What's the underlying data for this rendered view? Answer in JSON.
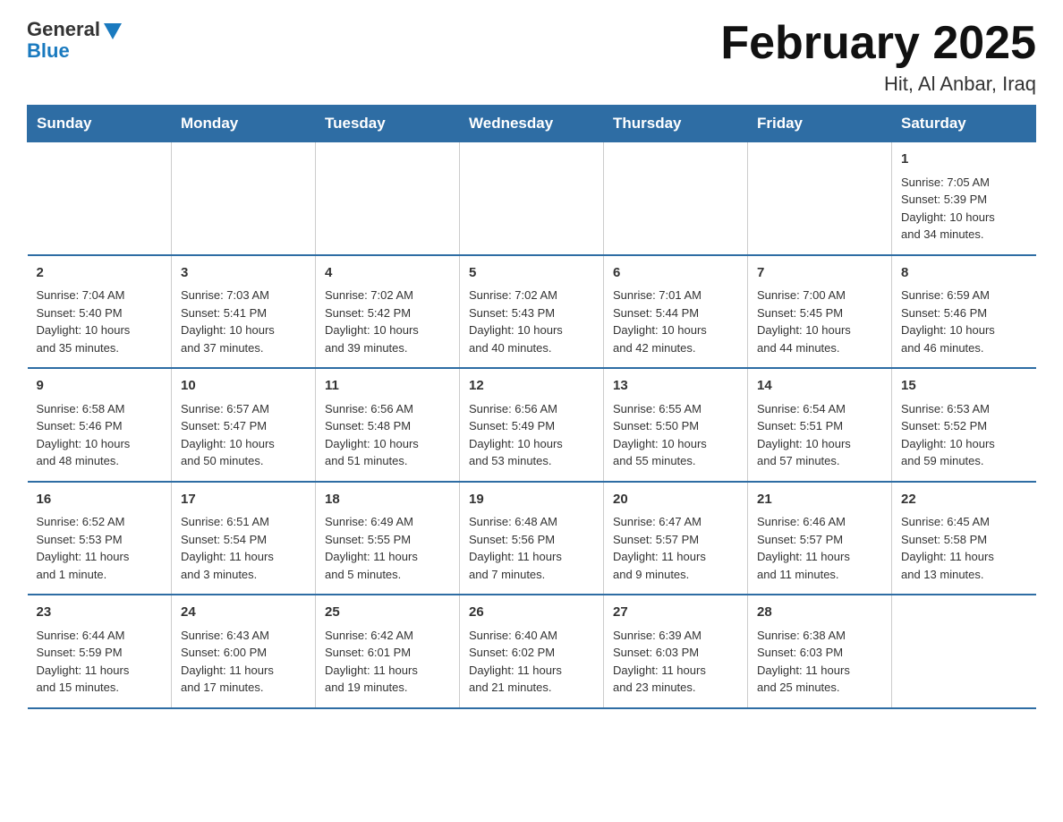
{
  "logo": {
    "general": "General",
    "blue": "Blue"
  },
  "title": "February 2025",
  "subtitle": "Hit, Al Anbar, Iraq",
  "days_of_week": [
    "Sunday",
    "Monday",
    "Tuesday",
    "Wednesday",
    "Thursday",
    "Friday",
    "Saturday"
  ],
  "weeks": [
    [
      {
        "day": "",
        "info": ""
      },
      {
        "day": "",
        "info": ""
      },
      {
        "day": "",
        "info": ""
      },
      {
        "day": "",
        "info": ""
      },
      {
        "day": "",
        "info": ""
      },
      {
        "day": "",
        "info": ""
      },
      {
        "day": "1",
        "info": "Sunrise: 7:05 AM\nSunset: 5:39 PM\nDaylight: 10 hours\nand 34 minutes."
      }
    ],
    [
      {
        "day": "2",
        "info": "Sunrise: 7:04 AM\nSunset: 5:40 PM\nDaylight: 10 hours\nand 35 minutes."
      },
      {
        "day": "3",
        "info": "Sunrise: 7:03 AM\nSunset: 5:41 PM\nDaylight: 10 hours\nand 37 minutes."
      },
      {
        "day": "4",
        "info": "Sunrise: 7:02 AM\nSunset: 5:42 PM\nDaylight: 10 hours\nand 39 minutes."
      },
      {
        "day": "5",
        "info": "Sunrise: 7:02 AM\nSunset: 5:43 PM\nDaylight: 10 hours\nand 40 minutes."
      },
      {
        "day": "6",
        "info": "Sunrise: 7:01 AM\nSunset: 5:44 PM\nDaylight: 10 hours\nand 42 minutes."
      },
      {
        "day": "7",
        "info": "Sunrise: 7:00 AM\nSunset: 5:45 PM\nDaylight: 10 hours\nand 44 minutes."
      },
      {
        "day": "8",
        "info": "Sunrise: 6:59 AM\nSunset: 5:46 PM\nDaylight: 10 hours\nand 46 minutes."
      }
    ],
    [
      {
        "day": "9",
        "info": "Sunrise: 6:58 AM\nSunset: 5:46 PM\nDaylight: 10 hours\nand 48 minutes."
      },
      {
        "day": "10",
        "info": "Sunrise: 6:57 AM\nSunset: 5:47 PM\nDaylight: 10 hours\nand 50 minutes."
      },
      {
        "day": "11",
        "info": "Sunrise: 6:56 AM\nSunset: 5:48 PM\nDaylight: 10 hours\nand 51 minutes."
      },
      {
        "day": "12",
        "info": "Sunrise: 6:56 AM\nSunset: 5:49 PM\nDaylight: 10 hours\nand 53 minutes."
      },
      {
        "day": "13",
        "info": "Sunrise: 6:55 AM\nSunset: 5:50 PM\nDaylight: 10 hours\nand 55 minutes."
      },
      {
        "day": "14",
        "info": "Sunrise: 6:54 AM\nSunset: 5:51 PM\nDaylight: 10 hours\nand 57 minutes."
      },
      {
        "day": "15",
        "info": "Sunrise: 6:53 AM\nSunset: 5:52 PM\nDaylight: 10 hours\nand 59 minutes."
      }
    ],
    [
      {
        "day": "16",
        "info": "Sunrise: 6:52 AM\nSunset: 5:53 PM\nDaylight: 11 hours\nand 1 minute."
      },
      {
        "day": "17",
        "info": "Sunrise: 6:51 AM\nSunset: 5:54 PM\nDaylight: 11 hours\nand 3 minutes."
      },
      {
        "day": "18",
        "info": "Sunrise: 6:49 AM\nSunset: 5:55 PM\nDaylight: 11 hours\nand 5 minutes."
      },
      {
        "day": "19",
        "info": "Sunrise: 6:48 AM\nSunset: 5:56 PM\nDaylight: 11 hours\nand 7 minutes."
      },
      {
        "day": "20",
        "info": "Sunrise: 6:47 AM\nSunset: 5:57 PM\nDaylight: 11 hours\nand 9 minutes."
      },
      {
        "day": "21",
        "info": "Sunrise: 6:46 AM\nSunset: 5:57 PM\nDaylight: 11 hours\nand 11 minutes."
      },
      {
        "day": "22",
        "info": "Sunrise: 6:45 AM\nSunset: 5:58 PM\nDaylight: 11 hours\nand 13 minutes."
      }
    ],
    [
      {
        "day": "23",
        "info": "Sunrise: 6:44 AM\nSunset: 5:59 PM\nDaylight: 11 hours\nand 15 minutes."
      },
      {
        "day": "24",
        "info": "Sunrise: 6:43 AM\nSunset: 6:00 PM\nDaylight: 11 hours\nand 17 minutes."
      },
      {
        "day": "25",
        "info": "Sunrise: 6:42 AM\nSunset: 6:01 PM\nDaylight: 11 hours\nand 19 minutes."
      },
      {
        "day": "26",
        "info": "Sunrise: 6:40 AM\nSunset: 6:02 PM\nDaylight: 11 hours\nand 21 minutes."
      },
      {
        "day": "27",
        "info": "Sunrise: 6:39 AM\nSunset: 6:03 PM\nDaylight: 11 hours\nand 23 minutes."
      },
      {
        "day": "28",
        "info": "Sunrise: 6:38 AM\nSunset: 6:03 PM\nDaylight: 11 hours\nand 25 minutes."
      },
      {
        "day": "",
        "info": ""
      }
    ]
  ]
}
